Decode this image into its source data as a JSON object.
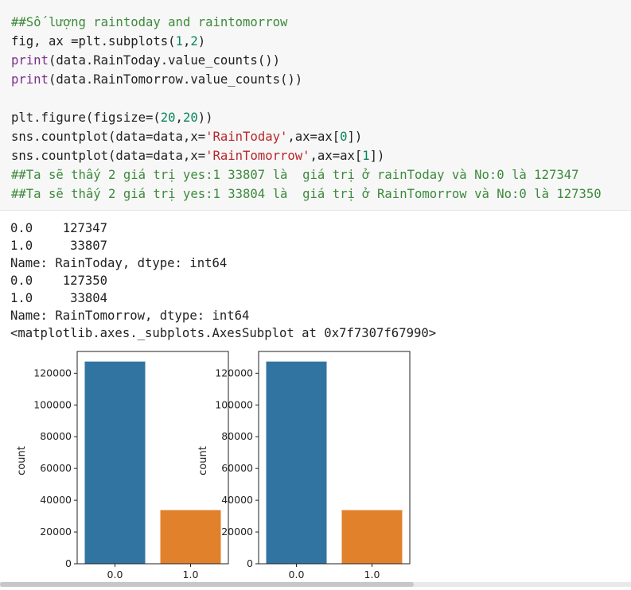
{
  "code_cell": {
    "lines": [
      [
        {
          "t": "##Số lượng raintoday and raintomorrow",
          "c": "cm"
        }
      ],
      [
        {
          "t": "fig, ax =plt.subplots(",
          "c": ""
        },
        {
          "t": "1",
          "c": "nu"
        },
        {
          "t": ",",
          "c": ""
        },
        {
          "t": "2",
          "c": "nu"
        },
        {
          "t": ")",
          "c": ""
        }
      ],
      [
        {
          "t": "print",
          "c": "kw"
        },
        {
          "t": "(data.RainToday.value_counts())",
          "c": ""
        }
      ],
      [
        {
          "t": "print",
          "c": "kw"
        },
        {
          "t": "(data.RainTomorrow.value_counts())",
          "c": ""
        }
      ],
      [],
      [
        {
          "t": "plt.figure(figsize=(",
          "c": ""
        },
        {
          "t": "20",
          "c": "nu"
        },
        {
          "t": ",",
          "c": ""
        },
        {
          "t": "20",
          "c": "nu"
        },
        {
          "t": "))",
          "c": ""
        }
      ],
      [
        {
          "t": "sns.countplot(data=data,x=",
          "c": ""
        },
        {
          "t": "'RainToday'",
          "c": "st"
        },
        {
          "t": ",ax=ax[",
          "c": ""
        },
        {
          "t": "0",
          "c": "nu"
        },
        {
          "t": "])",
          "c": ""
        }
      ],
      [
        {
          "t": "sns.countplot(data=data,x=",
          "c": ""
        },
        {
          "t": "'RainTomorrow'",
          "c": "st"
        },
        {
          "t": ",ax=ax[",
          "c": ""
        },
        {
          "t": "1",
          "c": "nu"
        },
        {
          "t": "])",
          "c": ""
        }
      ],
      [
        {
          "t": "##Ta sẽ thấy 2 giá trị yes:1 33807 là  giá trị ở rainToday và No:0 là 127347",
          "c": "cm"
        }
      ],
      [
        {
          "t": "##Ta sẽ thấy 2 giá trị yes:1 33804 là  giá trị ở RainTomorrow và No:0 là 127350",
          "c": "cm"
        }
      ]
    ]
  },
  "output": {
    "text_lines": [
      "0.0    127347",
      "1.0     33807",
      "Name: RainToday, dtype: int64",
      "0.0    127350",
      "1.0     33804",
      "Name: RainTomorrow, dtype: int64",
      "<matplotlib.axes._subplots.AxesSubplot at 0x7f7307f67990>"
    ]
  },
  "chart_data": [
    {
      "type": "bar",
      "categories": [
        "0.0",
        "1.0"
      ],
      "values": [
        127347,
        33807
      ],
      "colors": [
        "#3274a1",
        "#e1812c"
      ],
      "xlabel": "",
      "ylabel": "count",
      "ylim": [
        0,
        133700
      ],
      "yticks": [
        0,
        20000,
        40000,
        60000,
        80000,
        100000,
        120000
      ],
      "grid": false
    },
    {
      "type": "bar",
      "categories": [
        "0.0",
        "1.0"
      ],
      "values": [
        127350,
        33804
      ],
      "colors": [
        "#3274a1",
        "#e1812c"
      ],
      "xlabel": "",
      "ylabel": "count",
      "ylim": [
        0,
        133700
      ],
      "yticks": [
        0,
        20000,
        40000,
        60000,
        80000,
        100000,
        120000
      ],
      "grid": false
    }
  ]
}
